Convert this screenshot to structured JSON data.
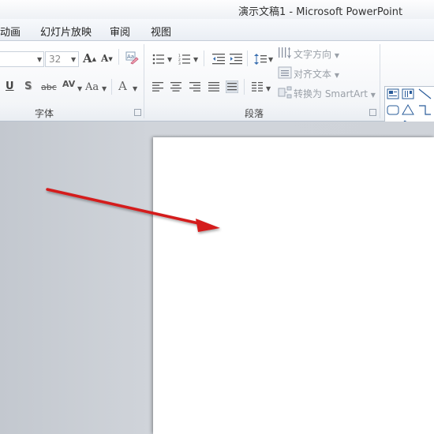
{
  "window": {
    "title": "演示文稿1  -  Microsoft PowerPoint"
  },
  "tabs": [
    {
      "label": "动画"
    },
    {
      "label": "幻灯片放映"
    },
    {
      "label": "审阅"
    },
    {
      "label": "视图"
    }
  ],
  "ribbon": {
    "font_group": {
      "label": "字体",
      "font_size": "32",
      "buttons": {
        "grow": "A",
        "shrink": "A",
        "underline": "U",
        "shadow": "S",
        "strike": "abc",
        "spacing": "AV",
        "case": "Aa",
        "color": "A"
      }
    },
    "paragraph_group": {
      "label": "段落",
      "text_direction": "文字方向",
      "align_text": "对齐文本",
      "convert_smartart": "转换为 SmartArt"
    }
  },
  "colors": {
    "accent_red": "#d41a1a",
    "slide": "#ffffff",
    "workspace": "#c9cdd4"
  }
}
